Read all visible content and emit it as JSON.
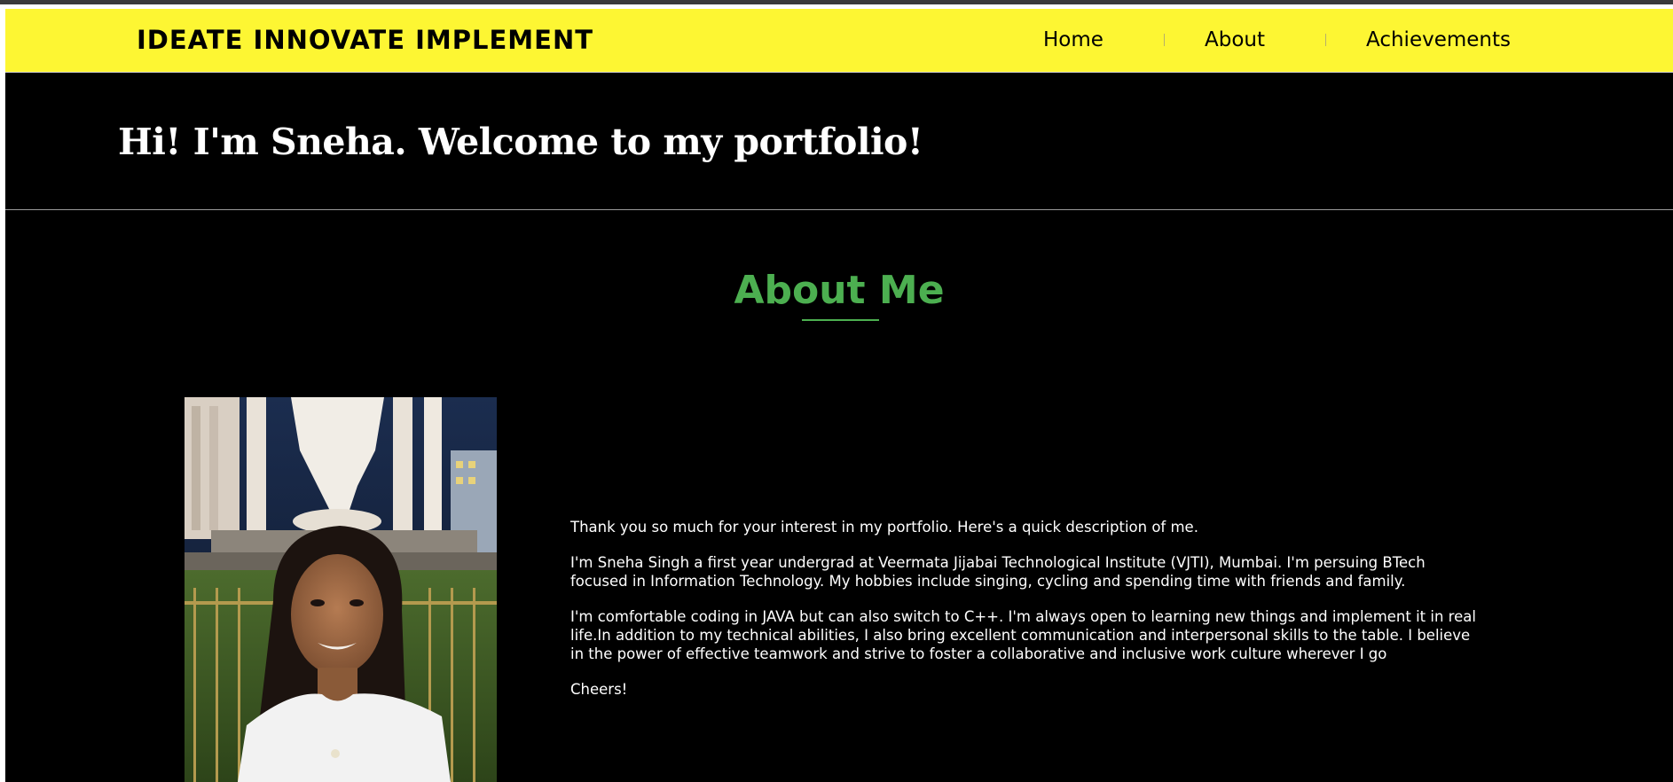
{
  "navbar": {
    "brand": "IDEATE INNOVATE IMPLEMENT",
    "items": [
      {
        "label": "Home"
      },
      {
        "label": "About"
      },
      {
        "label": "Achievements"
      }
    ]
  },
  "hero": {
    "title": "Hi! I'm Sneha. Welcome to my portfolio!"
  },
  "about": {
    "heading": "About Me",
    "photo_icon": "profile-photo",
    "paragraphs": [
      "Thank you so much for your interest in my portfolio. Here's a quick description of me.",
      "I'm Sneha Singh a first year undergrad at Veermata Jijabai Technological Institute (VJTI), Mumbai. I'm persuing BTech focused in Information Technology. My hobbies include singing, cycling and spending time with friends and family.",
      "I'm comfortable coding in JAVA but can also switch to C++. I'm always open to learning new things and implement it in real life.In addition to my technical abilities, I also bring excellent communication and interpersonal skills to the table. I believe in the power of effective teamwork and strive to foster a collaborative and inclusive work culture wherever I go",
      "Cheers!"
    ]
  },
  "colors": {
    "navbar_bg": "#fdf633",
    "page_bg": "#000000",
    "accent_green": "#4caf50",
    "text_white": "#ffffff"
  }
}
